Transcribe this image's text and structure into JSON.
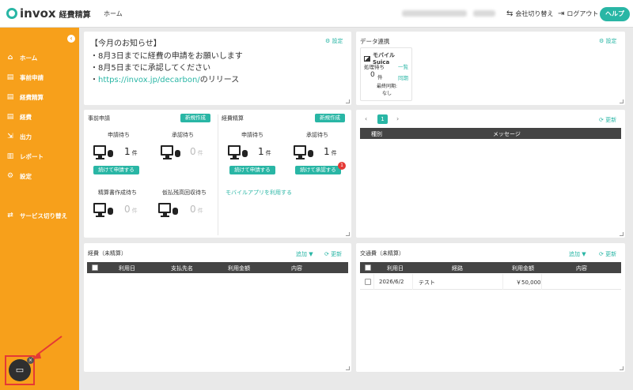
{
  "header": {
    "logo_text": "invox",
    "logo_sub": "経費精算",
    "nav_home": "ホーム",
    "switch_company": "会社切り替え",
    "logout": "ログアウト",
    "help": "ヘルプ"
  },
  "sidebar": {
    "items": [
      {
        "label": "ホーム",
        "icon": "home-icon"
      },
      {
        "label": "事前申請",
        "icon": "document-icon"
      },
      {
        "label": "経費精算",
        "icon": "document-icon"
      },
      {
        "label": "経費",
        "icon": "document-icon"
      },
      {
        "label": "出力",
        "icon": "export-icon"
      },
      {
        "label": "レポート",
        "icon": "chart-icon"
      },
      {
        "label": "設定",
        "icon": "gear-icon"
      },
      {
        "label": "サービス切り替え",
        "icon": "switch-icon"
      }
    ]
  },
  "notice": {
    "title": "【今月のお知らせ】",
    "settings": "設定",
    "lines": [
      "・8月3日までに経費の申請をお願いします",
      "・8月5日までに承認してください"
    ],
    "link_prefix": "・",
    "link_text": "https://invox.jp/decarbon/",
    "link_suffix": "のリリース"
  },
  "data_link": {
    "title": "データ連携",
    "settings": "設定",
    "card_title": "モバイルSuica",
    "pending_label": "処理待ち",
    "list_link": "一覧",
    "count": "0",
    "count_unit": "件",
    "sync_link": "同期",
    "last_sync_label": "最終同期:",
    "last_sync_value": "なし"
  },
  "pre_app": {
    "title": "事前申請",
    "new_button": "新規作成",
    "waiting_label": "申請待ち",
    "waiting_count": "1",
    "approval_label": "承認待ち",
    "approval_count": "0",
    "continue_button": "続けて申請する",
    "doc_label": "精算書作成待ち",
    "doc_count": "0",
    "advance_label": "仮払残高回収待ち",
    "advance_count": "0",
    "unit": "件"
  },
  "expense_settle": {
    "title": "経費精算",
    "new_button": "新規作成",
    "waiting_label": "申請待ち",
    "waiting_count": "1",
    "approval_label": "承認待ち",
    "approval_count": "1",
    "continue_apply_button": "続けて申請する",
    "continue_approve_button": "続けて承認する",
    "badge": "1",
    "mobile_link": "モバイルアプリを利用する",
    "unit": "件"
  },
  "messages": {
    "page": "1",
    "refresh": "更新",
    "col_type": "種別",
    "col_message": "メッセージ"
  },
  "expenses": {
    "title": "経費（未精算）",
    "add": "追加",
    "refresh": "更新",
    "columns": [
      "利用日",
      "支払先名",
      "利用金額",
      "内容"
    ]
  },
  "transport": {
    "title": "交通費（未精算）",
    "add": "追加",
    "refresh": "更新",
    "columns": [
      "利用日",
      "経路",
      "利用金額",
      "内容"
    ],
    "rows": [
      {
        "date": "2026/6/2",
        "route": "テスト",
        "amount": "￥50,000",
        "content": ""
      }
    ]
  },
  "colors": {
    "accent": "#29b6a5",
    "sidebar": "#f7a01b",
    "badge": "#e53935"
  }
}
